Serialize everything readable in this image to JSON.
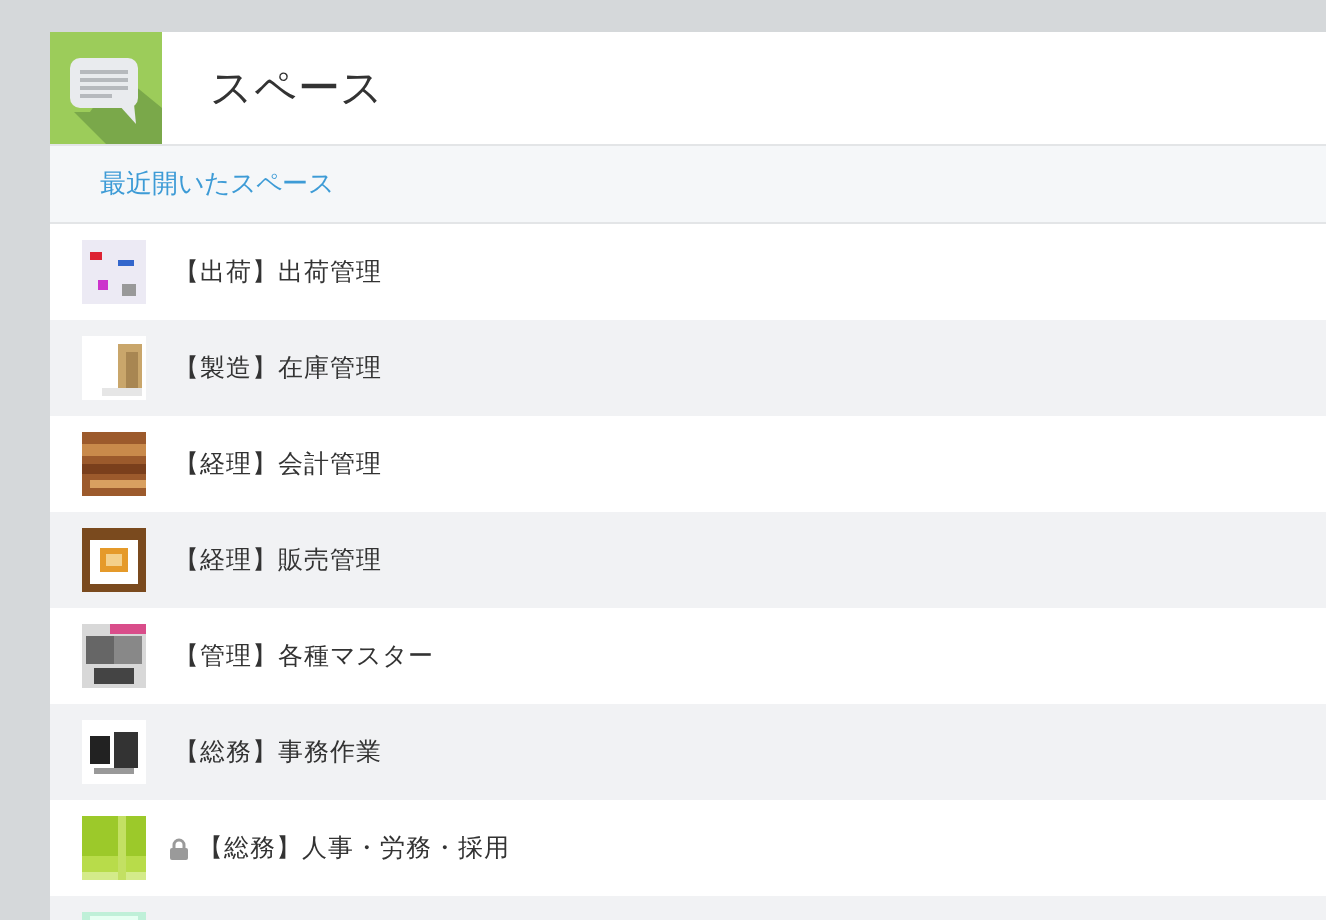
{
  "header": {
    "title": "スペース"
  },
  "section": {
    "label": "最近開いたスペース"
  },
  "spaces": [
    {
      "name": "【出荷】出荷管理",
      "locked": false
    },
    {
      "name": "【製造】在庫管理",
      "locked": false
    },
    {
      "name": "【経理】会計管理",
      "locked": false
    },
    {
      "name": "【経理】販売管理",
      "locked": false
    },
    {
      "name": "【管理】各種マスター",
      "locked": false
    },
    {
      "name": "【総務】事務作業",
      "locked": false
    },
    {
      "name": "【総務】人事・労務・採用",
      "locked": true
    },
    {
      "locked": false
    }
  ]
}
